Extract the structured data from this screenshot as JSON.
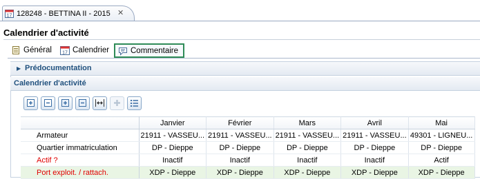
{
  "editor_tab": {
    "title": "128248 - BETTINA II - 2015",
    "close_glyph": "✕",
    "icon": "calendar-icon"
  },
  "page": {
    "title": "Calendrier d'activité"
  },
  "subtabs": [
    {
      "label": "Général",
      "icon": "document-icon"
    },
    {
      "label": "Calendrier",
      "icon": "calendar-icon"
    },
    {
      "label": "Commentaire",
      "icon": "comment-icon",
      "selected": true
    }
  ],
  "sections": {
    "predoc": {
      "label": "Prédocumentation",
      "arrow": "▶"
    },
    "calendar": {
      "label": "Calendrier d'activité"
    }
  },
  "toolbar": {
    "buttons": [
      "expand-all",
      "collapse-all",
      "expand",
      "collapse",
      "fit-columns",
      "add",
      "list"
    ]
  },
  "table": {
    "columns": [
      "",
      "Janvier",
      "Février",
      "Mars",
      "Avril",
      "Mai"
    ],
    "rows": [
      {
        "label": "Armateur",
        "cells": [
          "21911 - VASSEU...",
          "21911 - VASSEU...",
          "21911 - VASSEU...",
          "21911 - VASSEU...",
          "49301 - LIGNEU..."
        ]
      },
      {
        "label": "Quartier immatriculation",
        "cells": [
          "DP - Dieppe",
          "DP - Dieppe",
          "DP - Dieppe",
          "DP - Dieppe",
          "DP - Dieppe"
        ]
      },
      {
        "label": "Actif ?",
        "cells": [
          "Inactif",
          "Inactif",
          "Inactif",
          "Inactif",
          "Actif"
        ]
      },
      {
        "label": "Port exploit. / rattach.",
        "cells": [
          "XDP - Dieppe",
          "XDP - Dieppe",
          "XDP - Dieppe",
          "XDP - Dieppe",
          "XDP - Dieppe"
        ]
      }
    ]
  },
  "colors": {
    "accent": "#21517e",
    "required": "#e00000",
    "selected_border": "#2e8b57",
    "row_highlight": "#e9f5e4"
  }
}
